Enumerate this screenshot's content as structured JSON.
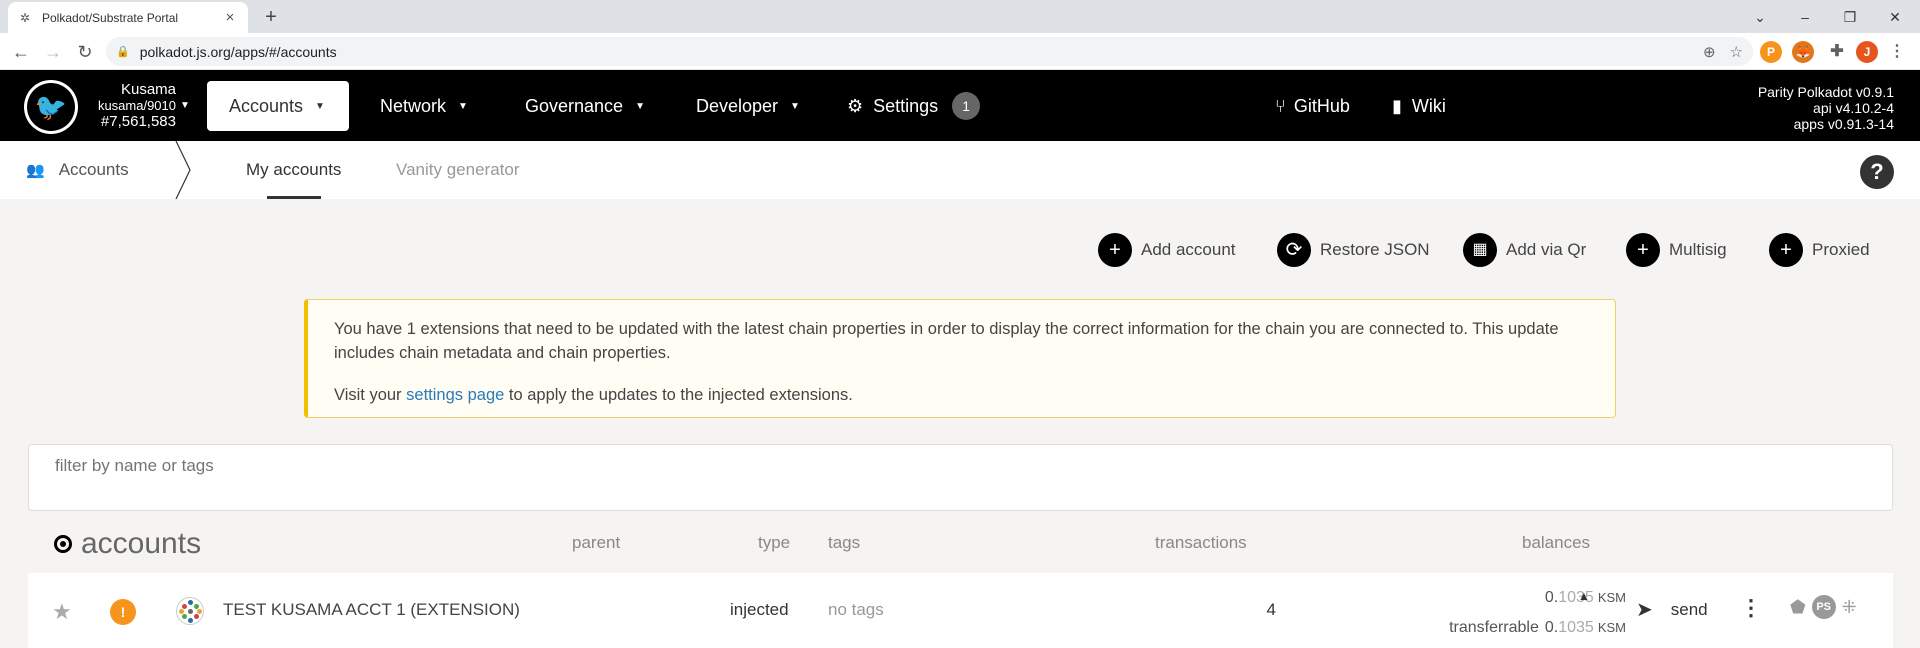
{
  "browser": {
    "tab_title": "Polkadot/Substrate Portal",
    "url": "polkadot.js.org/apps/#/accounts",
    "profile_initial": "J",
    "ext_badge": "1"
  },
  "header": {
    "chain_name": "Kusama",
    "chain_spec": "kusama/9010",
    "block": "#7,561,583",
    "menu": {
      "accounts": "Accounts",
      "network": "Network",
      "governance": "Governance",
      "developer": "Developer",
      "settings": "Settings",
      "settings_badge": "1",
      "github": "GitHub",
      "wiki": "Wiki"
    },
    "versions": [
      "Parity Polkadot v0.9.1",
      "api v4.10.2-4",
      "apps v0.91.3-14"
    ]
  },
  "subnav": {
    "root": "Accounts",
    "tabs": [
      "My accounts",
      "Vanity generator"
    ]
  },
  "actions": [
    "Add account",
    "Restore JSON",
    "Add via Qr",
    "Multisig",
    "Proxied"
  ],
  "banner": {
    "line1": "You have 1 extensions that need to be updated with the latest chain properties in order to display the correct information for the chain you are connected to. This update includes chain metadata and chain properties.",
    "line2_pre": "Visit your ",
    "line2_link": "settings page",
    "line2_post": " to apply the updates to the injected extensions."
  },
  "filter": {
    "placeholder": "filter by name or tags"
  },
  "table": {
    "title": "accounts",
    "headers": {
      "parent": "parent",
      "type": "type",
      "tags": "tags",
      "transactions": "transactions",
      "balances": "balances"
    },
    "rows": [
      {
        "name": "TEST KUSAMA ACCT 1 (EXTENSION)",
        "type": "injected",
        "tags": "no tags",
        "transactions": "4",
        "balance_int": "0.",
        "balance_frac": "1035",
        "unit": "KSM",
        "transferrable_label": "transferrable",
        "transferrable_int": "0.",
        "transferrable_frac": "1035",
        "send": "send",
        "ps": "PS"
      }
    ]
  },
  "colors": {
    "warning": "#f0c000",
    "link": "#2b7bb9",
    "header_bg": "#000000",
    "warn_icon": "#f7941d"
  }
}
